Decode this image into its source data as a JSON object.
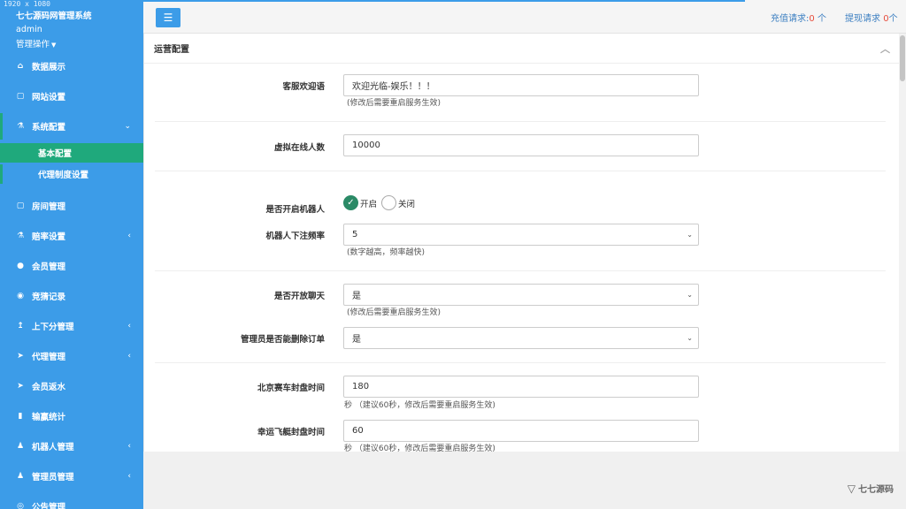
{
  "resolution_label": "1920 x 1080",
  "sidebar": {
    "brand": "七七源码网管理系统",
    "user": "admin",
    "ops_label": "管理操作",
    "items": [
      {
        "label": "数据展示",
        "icon": "home-icon",
        "glyph": "⌂"
      },
      {
        "label": "网站设置",
        "icon": "window-icon",
        "glyph": "▢"
      },
      {
        "label": "系统配置",
        "icon": "flask-icon",
        "glyph": "⚗",
        "chevron": "⌄"
      },
      {
        "label": "房间管理",
        "icon": "window-icon",
        "glyph": "▢"
      },
      {
        "label": "赔率设置",
        "icon": "flask-icon",
        "glyph": "⚗",
        "chevron": "‹"
      },
      {
        "label": "会员管理",
        "icon": "user-icon",
        "glyph": "●"
      },
      {
        "label": "竞猜记录",
        "icon": "car-icon",
        "glyph": "◉"
      },
      {
        "label": "上下分管理",
        "icon": "level-up-icon",
        "glyph": "↥",
        "chevron": "‹"
      },
      {
        "label": "代理管理",
        "icon": "send-icon",
        "glyph": "➤",
        "chevron": "‹"
      },
      {
        "label": "会员返水",
        "icon": "send-icon",
        "glyph": "➤"
      },
      {
        "label": "输赢统计",
        "icon": "bar-chart-icon",
        "glyph": "▮"
      },
      {
        "label": "机器人管理",
        "icon": "person-icon",
        "glyph": "♟",
        "chevron": "‹"
      },
      {
        "label": "管理员管理",
        "icon": "person-icon",
        "glyph": "♟",
        "chevron": "‹"
      },
      {
        "label": "公告管理",
        "icon": "bullhorn-icon",
        "glyph": "◎"
      }
    ],
    "subitems": [
      {
        "label": "基本配置"
      },
      {
        "label": "代理制度设置"
      }
    ]
  },
  "topbar": {
    "recharge_label": "充值请求:",
    "recharge_count": "0",
    "recharge_unit": "个",
    "withdraw_label": "提现请求",
    "withdraw_count": "0",
    "withdraw_unit": "个"
  },
  "panel": {
    "title": "运营配置",
    "fields": {
      "welcome": {
        "label": "客服欢迎语",
        "value": "欢迎光临-娱乐！！！",
        "help": "(修改后需要重启服务生效)"
      },
      "online": {
        "label": "虚拟在线人数",
        "value": "10000"
      },
      "robot_enable": {
        "label": "是否开启机器人",
        "on": "开启",
        "off": "关闭"
      },
      "robot_freq": {
        "label": "机器人下注频率",
        "value": "5",
        "help": "(数字越高，频率越快)"
      },
      "chat": {
        "label": "是否开放聊天",
        "value": "是",
        "help": "(修改后需要重启服务生效)"
      },
      "admin_delete": {
        "label": "管理员是否能删除订单",
        "value": "是"
      },
      "bj_close": {
        "label": "北京赛车封盘时间",
        "value": "180",
        "help": "秒 （建议60秒，修改后需要重启服务生效)"
      },
      "boat_close": {
        "label": "幸运飞艇封盘时间",
        "value": "60",
        "help": "秒 （建议60秒，修改后需要重启服务生效)"
      }
    }
  },
  "watermark": {
    "text": "七七源码"
  },
  "colors": {
    "sidebar": "#3c9ce8",
    "active": "#1fa97c",
    "alert": "#e74c3c"
  }
}
